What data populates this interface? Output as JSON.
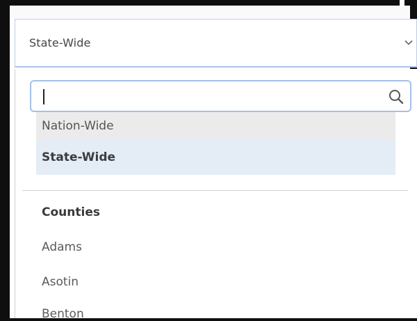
{
  "select": {
    "value": "State-Wide",
    "chevron_icon": "chevron-down-icon"
  },
  "search": {
    "placeholder": "",
    "value": "",
    "icon": "search-icon"
  },
  "options": [
    {
      "label": "Nation-Wide",
      "state": "hovered"
    },
    {
      "label": "State-Wide",
      "state": "selected"
    }
  ],
  "groups": [
    {
      "header": "Counties",
      "items": [
        "Adams",
        "Asotin",
        "Benton"
      ]
    }
  ],
  "colors": {
    "accent_border": "#a5bfe9",
    "selected_bg": "#e4ecf5",
    "hover_bg": "#ebebeb"
  }
}
